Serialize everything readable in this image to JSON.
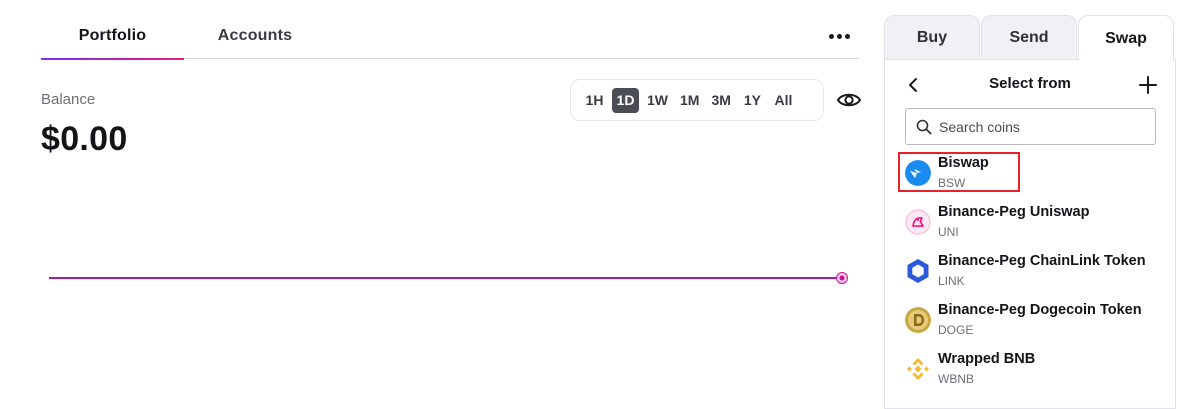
{
  "portfolio": {
    "tabs": [
      "Portfolio",
      "Accounts"
    ],
    "balance_label": "Balance",
    "balance_value": "$0.00",
    "time_ranges": [
      "1H",
      "1D",
      "1W",
      "1M",
      "3M",
      "1Y",
      "All"
    ],
    "active_range": "1D",
    "accent_gradient": [
      "#7b2ff7",
      "#e6197c"
    ],
    "chart_line_color": "#a41db0"
  },
  "swap": {
    "tabs": [
      "Buy",
      "Send",
      "Swap"
    ],
    "active_tab": "Swap",
    "title": "Select from",
    "search_placeholder": "Search coins",
    "highlight_color": "#e8212b",
    "coins": [
      {
        "name": "Biswap",
        "symbol": "BSW",
        "icon": "biswap-icon",
        "highlighted": true
      },
      {
        "name": "Binance-Peg Uniswap",
        "symbol": "UNI",
        "icon": "uniswap-icon",
        "highlighted": false
      },
      {
        "name": "Binance-Peg ChainLink Token",
        "symbol": "LINK",
        "icon": "chainlink-icon",
        "highlighted": false
      },
      {
        "name": "Binance-Peg Dogecoin Token",
        "symbol": "DOGE",
        "icon": "dogecoin-icon",
        "highlighted": false
      },
      {
        "name": "Wrapped BNB",
        "symbol": "WBNB",
        "icon": "bnb-icon",
        "highlighted": false
      }
    ]
  }
}
